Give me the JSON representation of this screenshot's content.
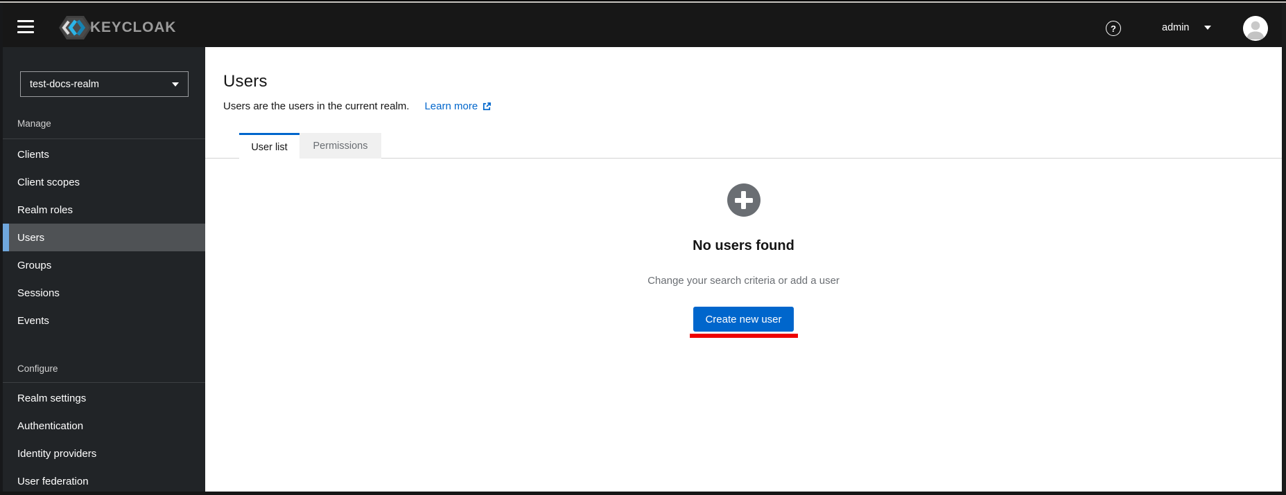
{
  "masthead": {
    "logo_text": "KEYCLOAK",
    "help_icon": "question-circle-icon",
    "username": "admin",
    "background_color": "#171717"
  },
  "sidebar": {
    "realm_selector": {
      "value": "test-docs-realm"
    },
    "sections": [
      {
        "label": "Manage",
        "items": [
          "Clients",
          "Client scopes",
          "Realm roles",
          "Users",
          "Groups",
          "Sessions",
          "Events"
        ]
      },
      {
        "label": "Configure",
        "items": [
          "Realm settings",
          "Authentication",
          "Identity providers",
          "User federation"
        ]
      }
    ],
    "selected_item": "Users",
    "background_color": "#212427",
    "selected_bg_color": "#4f5255",
    "selected_accent_color": "#6fa7dd"
  },
  "content": {
    "title": "Users",
    "subtitle": "Users are the users in the current realm.",
    "learn_more_label": "Learn more",
    "tabs": [
      {
        "label": "User list",
        "active": true
      },
      {
        "label": "Permissions",
        "active": false
      }
    ],
    "empty_state": {
      "icon": "add-circle-icon",
      "heading": "No users found",
      "description": "Change your search criteria or add a user",
      "primary_button": "Create new user"
    },
    "annotation": {
      "type": "red-underline",
      "color": "#ee0000"
    },
    "accent_color": "#0066cc"
  }
}
